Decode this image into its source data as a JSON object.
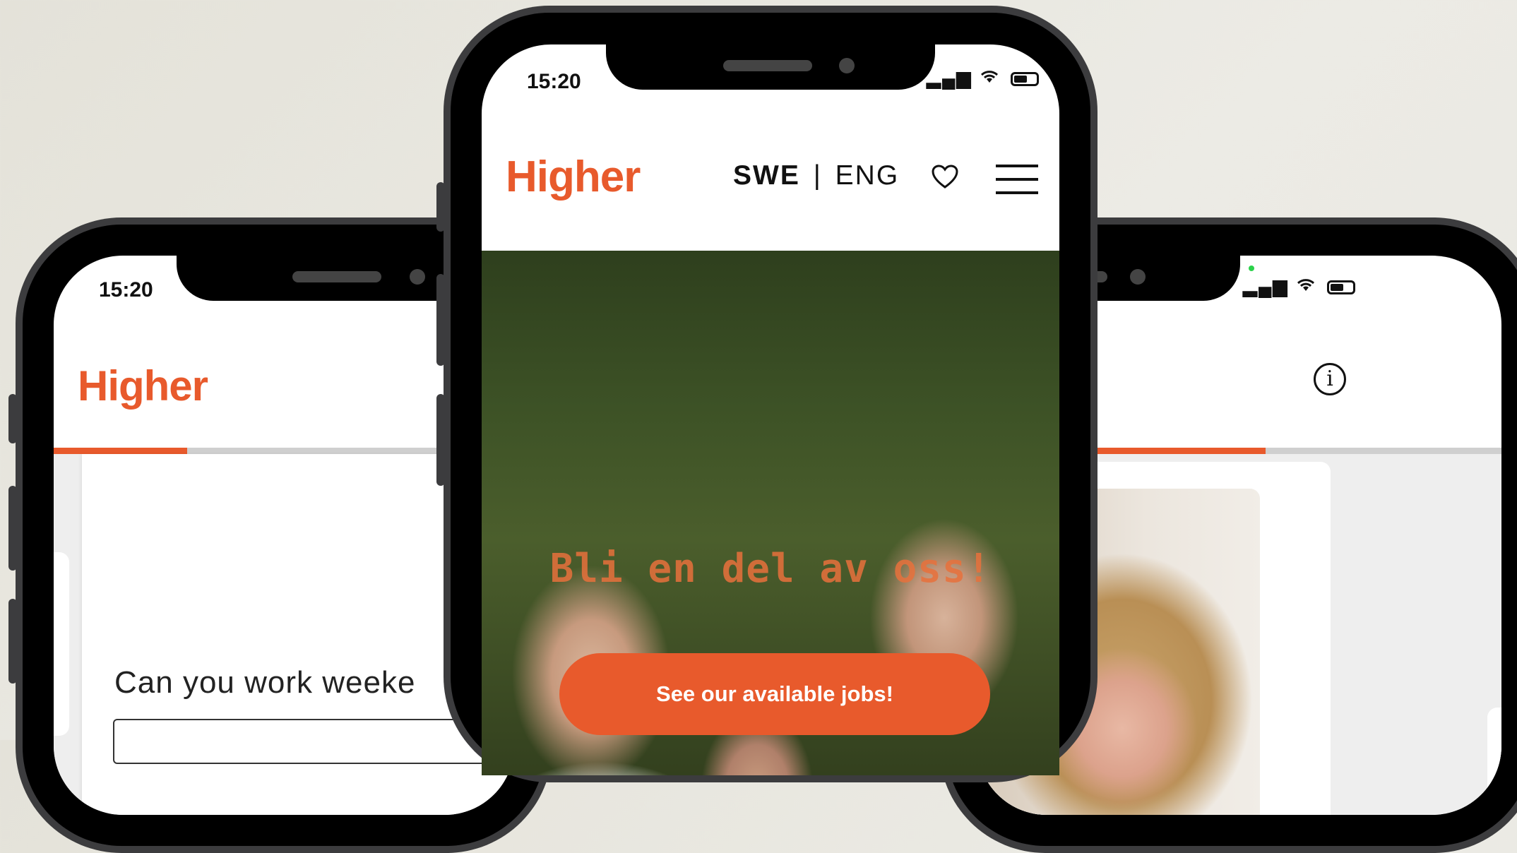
{
  "left_phone": {
    "status_time": "15:20",
    "logo": "Higher",
    "progress_fraction": 0.29,
    "question": "Can you work weeke"
  },
  "center_phone": {
    "status_time": "15:20",
    "logo": "Higher",
    "lang_swe": "SWE",
    "lang_sep": "|",
    "lang_eng": "ENG",
    "hero_title": "Bli en del av oss!",
    "cta_label": "See our available jobs!"
  },
  "right_phone": {
    "progress_fraction": 0.55
  },
  "colors": {
    "brand": "#e85a2c",
    "background": "#e6e5de"
  },
  "icons": [
    "heart-icon",
    "hamburger-menu-icon",
    "info-icon",
    "wifi-icon",
    "signal-icon",
    "battery-icon"
  ]
}
